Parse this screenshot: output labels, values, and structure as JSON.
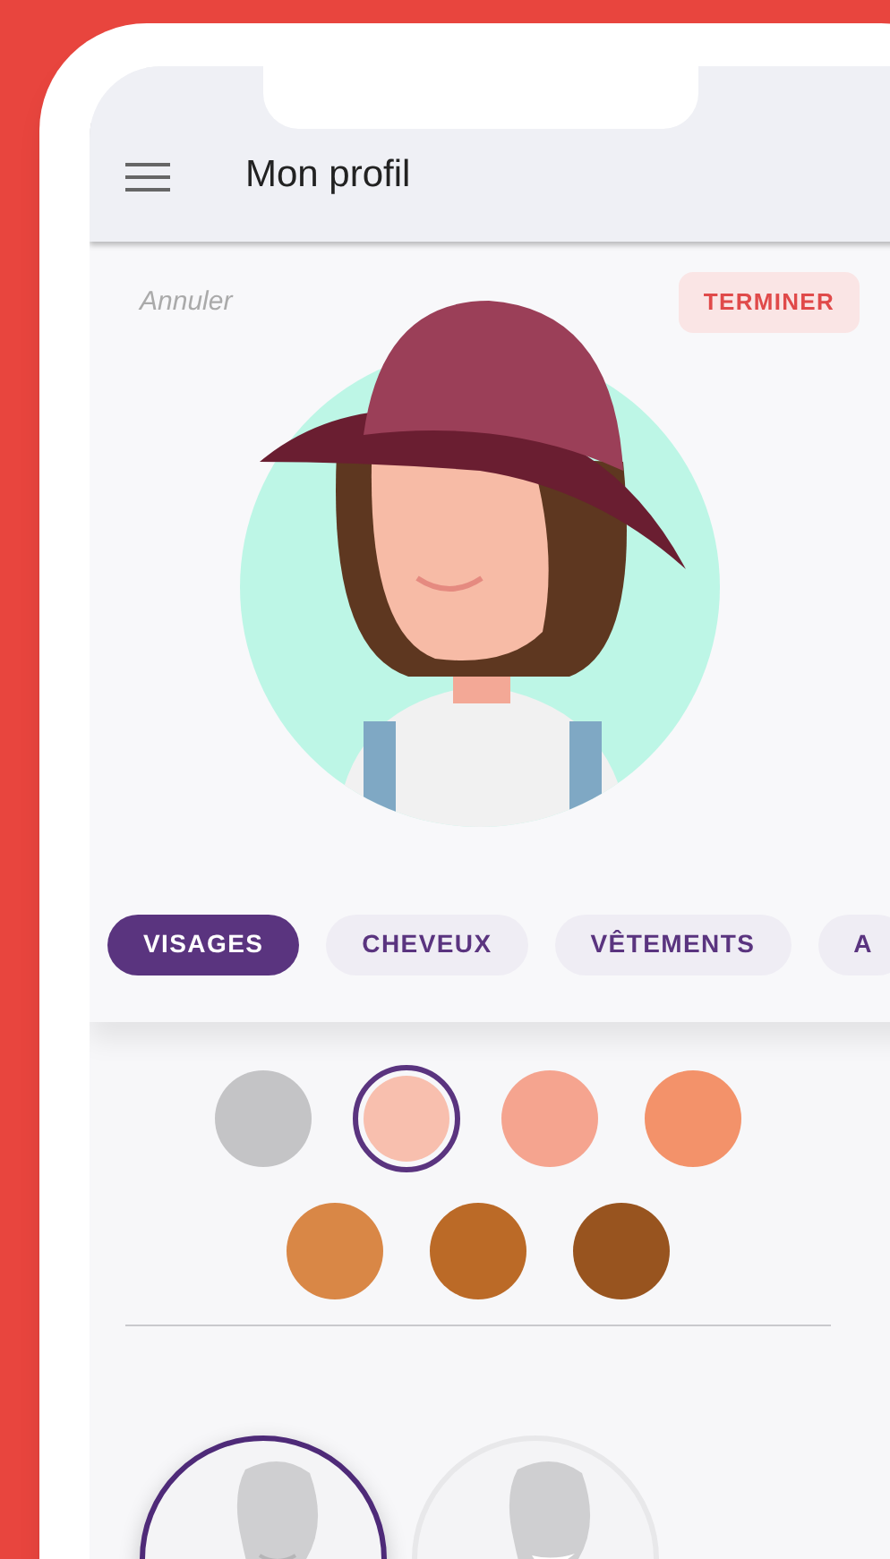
{
  "header": {
    "title": "Mon profil"
  },
  "actions": {
    "cancel": "Annuler",
    "done": "TERMINER"
  },
  "tabs": [
    {
      "label": "VISAGES",
      "selected": true
    },
    {
      "label": "CHEVEUX",
      "selected": false
    },
    {
      "label": "VÊTEMENTS",
      "selected": false
    },
    {
      "label": "A",
      "selected": false
    }
  ],
  "swatches": [
    {
      "color": "#c4c4c6",
      "selected": false
    },
    {
      "color": "#f8bfae",
      "selected": true
    },
    {
      "color": "#f5a48f",
      "selected": false
    },
    {
      "color": "#f3926a",
      "selected": false
    },
    {
      "color": "#d98746",
      "selected": false
    },
    {
      "color": "#bb6a27",
      "selected": false
    },
    {
      "color": "#98541f",
      "selected": false
    }
  ],
  "face_options": [
    {
      "kind": "smile",
      "selected": true
    },
    {
      "kind": "grin",
      "selected": false
    }
  ]
}
